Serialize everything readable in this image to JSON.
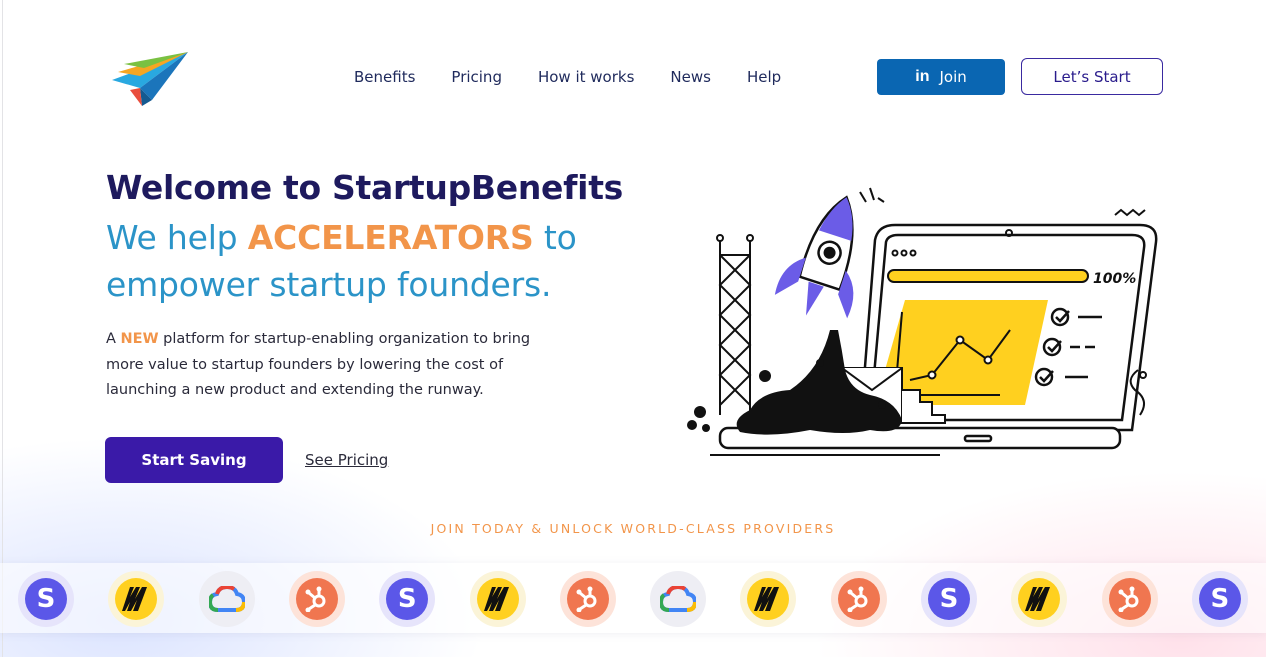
{
  "nav": {
    "items": [
      {
        "label": "Benefits"
      },
      {
        "label": "Pricing"
      },
      {
        "label": "How it works"
      },
      {
        "label": "News"
      },
      {
        "label": "Help"
      }
    ]
  },
  "header": {
    "join_label": "Join",
    "linkedin_glyph": "in",
    "start_label": "Let’s Start"
  },
  "hero": {
    "title": "Welcome to StartupBenefits",
    "subtitle_pre": "We help ",
    "subtitle_accent": "ACCELERATORS",
    "subtitle_post": " to empower startup founders.",
    "desc_pre": "A ",
    "desc_new": "NEW",
    "desc_post": " platform for startup-enabling organization to bring more value to startup founders by lowering the cost of launching a new product and extending the runway.",
    "cta_primary": "Start Saving",
    "cta_secondary": "See Pricing"
  },
  "illustration": {
    "progress_label": "100%"
  },
  "providers": {
    "title": "JOIN TODAY & UNLOCK WORLD-CLASS PROVIDERS",
    "stripe_glyph": "S",
    "items": [
      {
        "icon": "stripe-icon"
      },
      {
        "icon": "miro-icon"
      },
      {
        "icon": "google-cloud-icon"
      },
      {
        "icon": "hubspot-icon"
      },
      {
        "icon": "stripe-icon"
      },
      {
        "icon": "miro-icon"
      },
      {
        "icon": "hubspot-icon"
      },
      {
        "icon": "google-cloud-icon"
      },
      {
        "icon": "miro-icon"
      },
      {
        "icon": "hubspot-icon"
      },
      {
        "icon": "stripe-icon"
      },
      {
        "icon": "miro-icon"
      },
      {
        "icon": "hubspot-icon"
      },
      {
        "icon": "stripe-icon"
      }
    ]
  },
  "colors": {
    "brand_dark": "#1e1a5e",
    "brand_blue": "#2b94c8",
    "accent_orange": "#f2954a",
    "primary_button": "#3a1aa8",
    "linkedin_blue": "#0a66b2"
  }
}
